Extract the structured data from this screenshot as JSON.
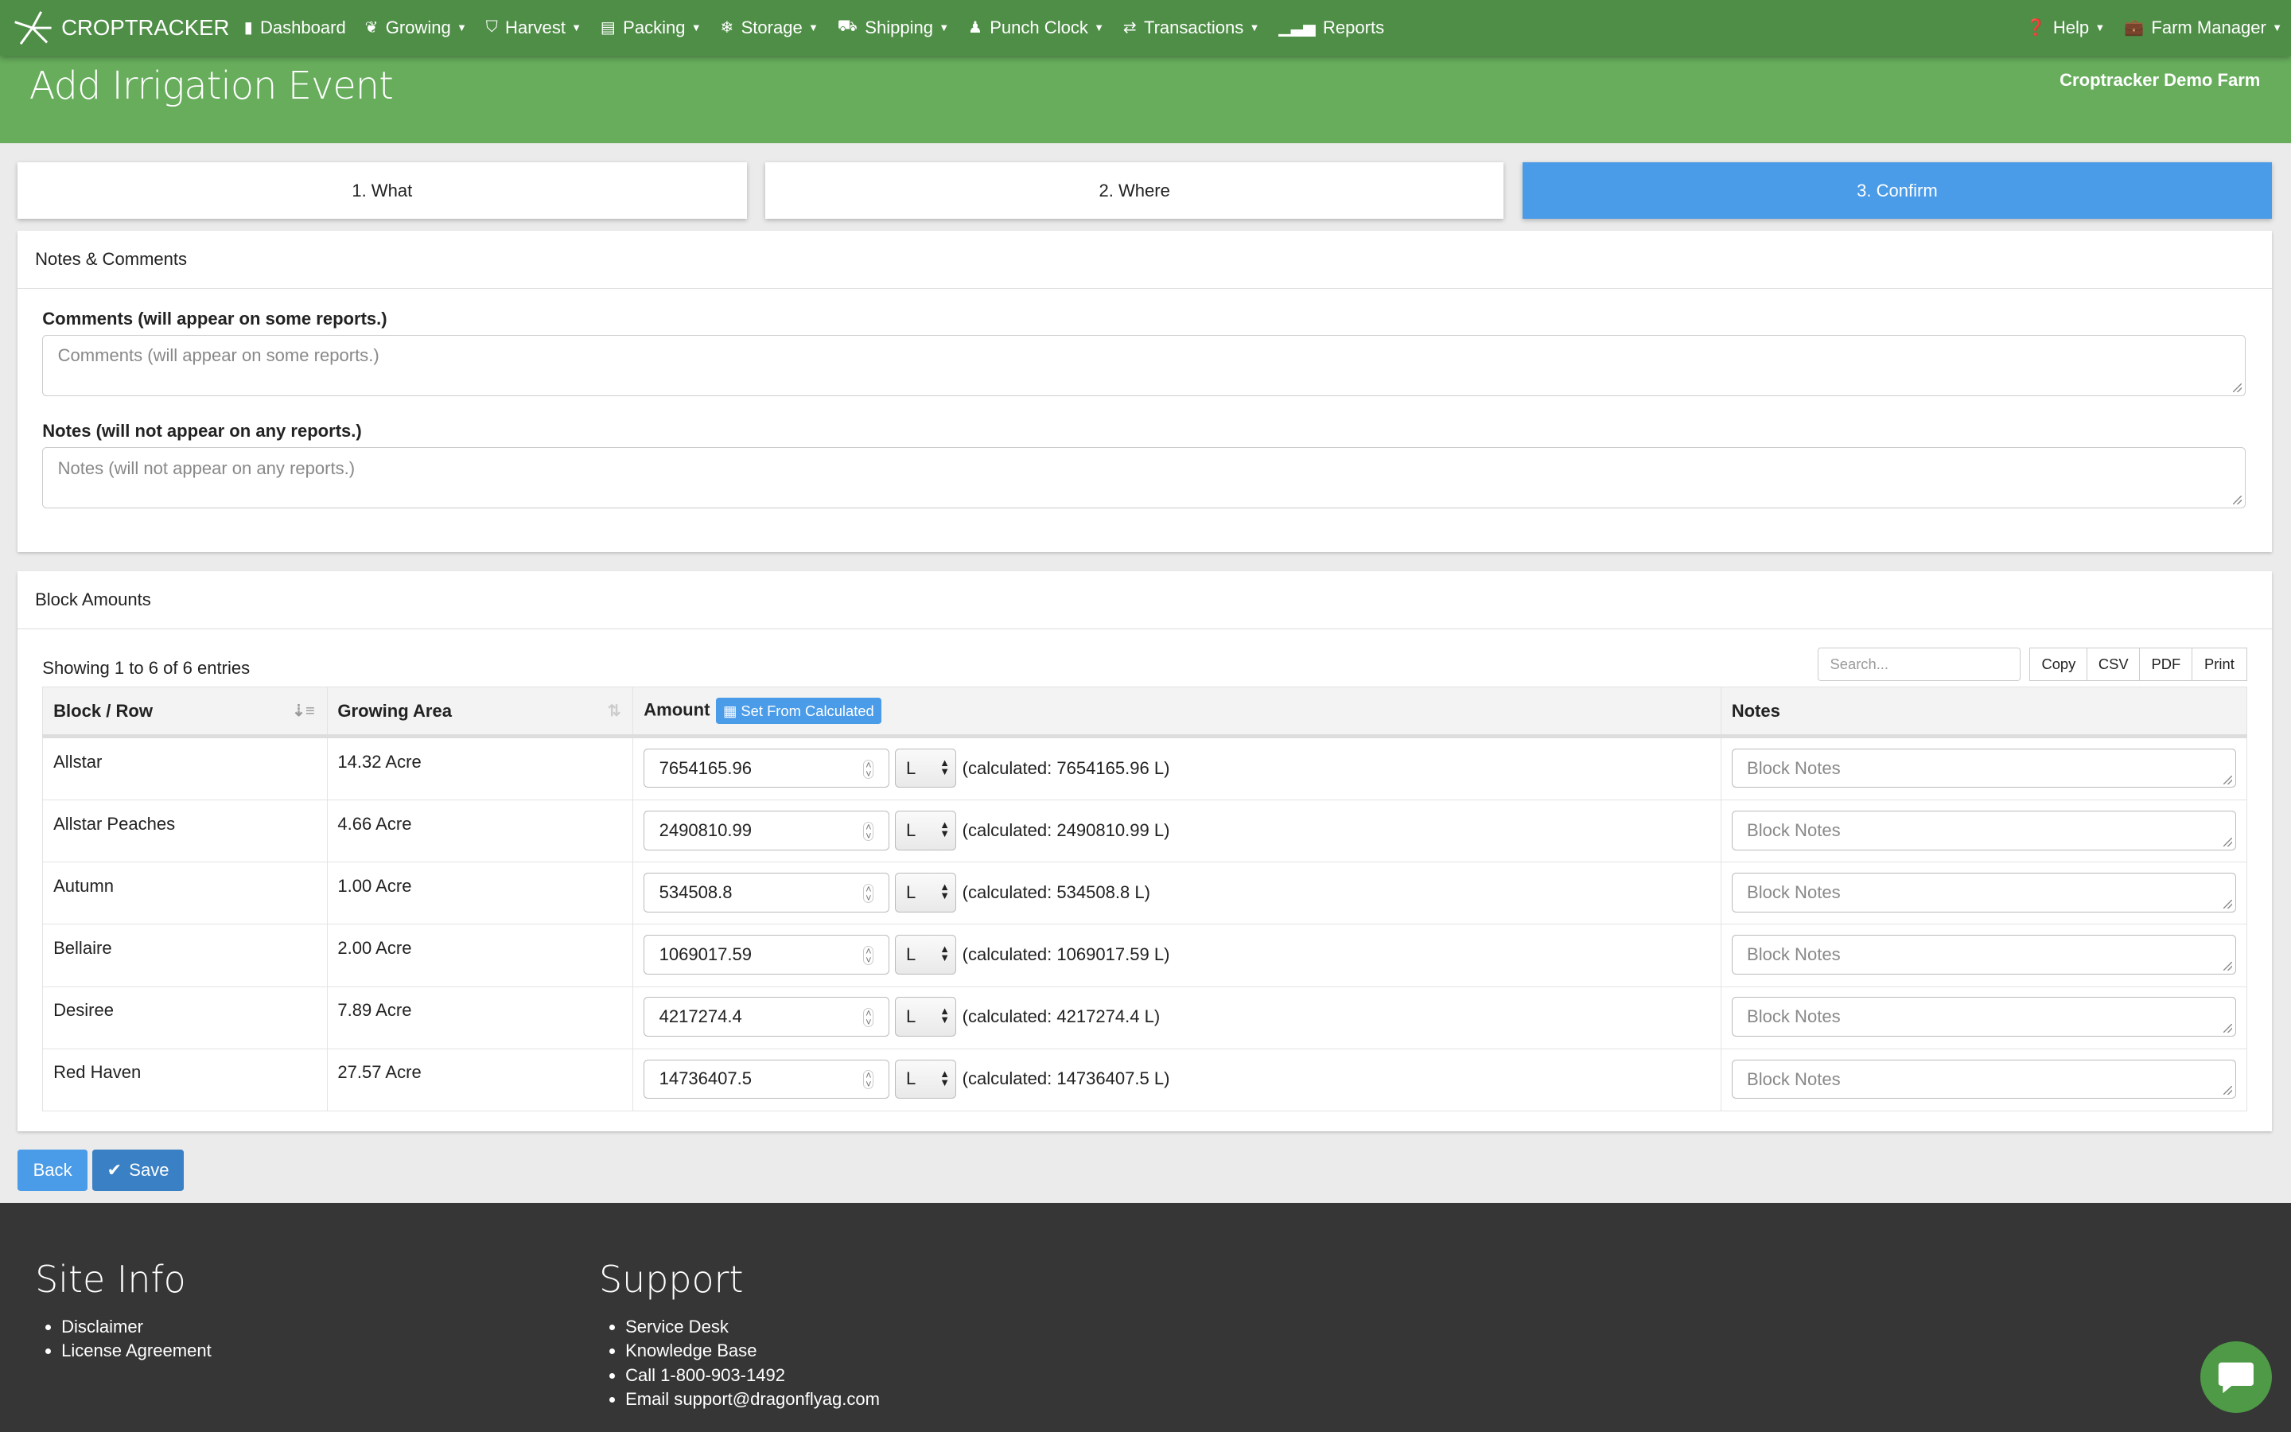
{
  "nav": {
    "brand": "CROPTRACKER",
    "items": [
      {
        "label": "Dashboard",
        "icon": "bookmark-icon",
        "dropdown": false
      },
      {
        "label": "Growing",
        "icon": "leaf-icon",
        "dropdown": true
      },
      {
        "label": "Harvest",
        "icon": "basket-icon",
        "dropdown": true
      },
      {
        "label": "Packing",
        "icon": "box-icon",
        "dropdown": true
      },
      {
        "label": "Storage",
        "icon": "snowflake-icon",
        "dropdown": true
      },
      {
        "label": "Shipping",
        "icon": "truck-icon",
        "dropdown": true
      },
      {
        "label": "Punch Clock",
        "icon": "user-icon",
        "dropdown": true
      },
      {
        "label": "Transactions",
        "icon": "exchange-icon",
        "dropdown": true
      },
      {
        "label": "Reports",
        "icon": "bar-chart-icon",
        "dropdown": false
      }
    ],
    "help": "Help",
    "farm_manager": "Farm Manager"
  },
  "header": {
    "title": "Add Irrigation Event",
    "farm": "Croptracker Demo Farm"
  },
  "steps": [
    "1. What",
    "2. Where",
    "3. Confirm"
  ],
  "notes_panel": {
    "title": "Notes & Comments",
    "comments_label": "Comments (will appear on some reports.)",
    "comments_placeholder": "Comments (will appear on some reports.)",
    "notes_label": "Notes (will not appear on any reports.)",
    "notes_placeholder": "Notes (will not appear on any reports.)"
  },
  "blocks_panel": {
    "title": "Block Amounts",
    "info": "Showing 1 to 6 of 6 entries",
    "search_placeholder": "Search...",
    "export": [
      "Copy",
      "CSV",
      "PDF",
      "Print"
    ],
    "columns": {
      "block": "Block / Row",
      "area": "Growing Area",
      "amount": "Amount",
      "set_calc": "Set From Calculated",
      "notes": "Notes"
    },
    "notes_placeholder": "Block Notes",
    "rows": [
      {
        "block": "Allstar",
        "area": "14.32 Acre",
        "amount": "7654165.96",
        "unit": "L",
        "calc": "(calculated: 7654165.96 L)"
      },
      {
        "block": "Allstar Peaches",
        "area": "4.66 Acre",
        "amount": "2490810.99",
        "unit": "L",
        "calc": "(calculated: 2490810.99 L)"
      },
      {
        "block": "Autumn",
        "area": "1.00 Acre",
        "amount": "534508.8",
        "unit": "L",
        "calc": "(calculated: 534508.8 L)"
      },
      {
        "block": "Bellaire",
        "area": "2.00 Acre",
        "amount": "1069017.59",
        "unit": "L",
        "calc": "(calculated: 1069017.59 L)"
      },
      {
        "block": "Desiree",
        "area": "7.89 Acre",
        "amount": "4217274.4",
        "unit": "L",
        "calc": "(calculated: 4217274.4 L)"
      },
      {
        "block": "Red Haven",
        "area": "27.57 Acre",
        "amount": "14736407.5",
        "unit": "L",
        "calc": "(calculated: 14736407.5 L)"
      }
    ]
  },
  "actions": {
    "back": "Back",
    "save": "Save"
  },
  "footer": {
    "site_info": {
      "title": "Site Info",
      "links": [
        "Disclaimer",
        "License Agreement"
      ]
    },
    "support": {
      "title": "Support",
      "links": [
        "Service Desk",
        "Knowledge Base",
        "Call 1-800-903-1492",
        "Email support@dragonflyag.com"
      ]
    }
  },
  "colors": {
    "nav": "#4f8e47",
    "header": "#67ad5c",
    "accent": "#4a9be8",
    "footer": "#363636"
  }
}
